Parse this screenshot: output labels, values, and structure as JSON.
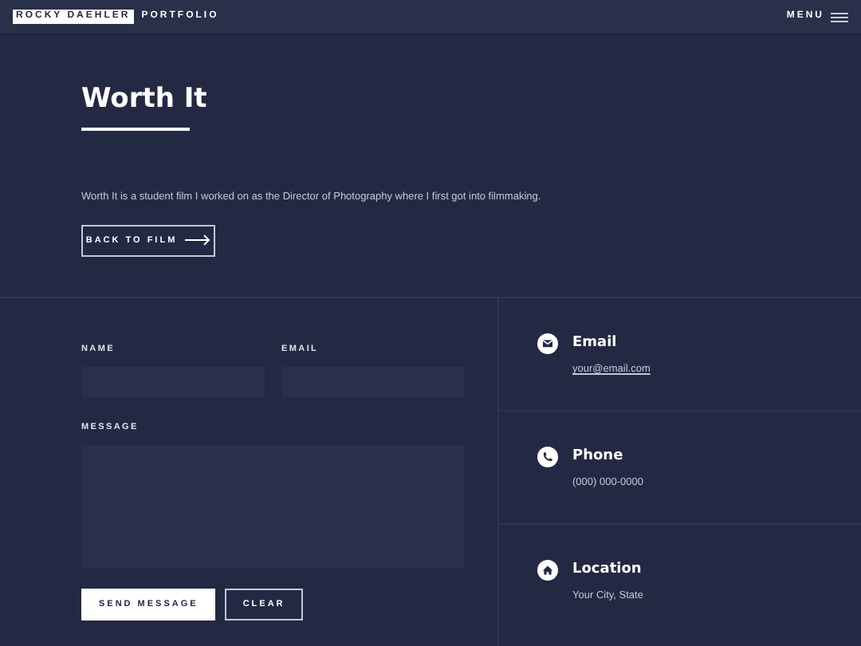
{
  "header": {
    "logo": "ROCKY DAEHLER",
    "subtitle": "PORTFOLIO",
    "menu": "MENU"
  },
  "banner": {
    "title": "Worth It",
    "description": "Worth It is a student film I worked on as the Director of Photography where I first got into filmmaking.",
    "button": "BACK TO FILM"
  },
  "form": {
    "name_label": "NAME",
    "email_label": "EMAIL",
    "message_label": "MESSAGE",
    "buttons": [
      "SEND MESSAGE",
      "CLEAR"
    ]
  },
  "contacts": [
    {
      "kind": "email",
      "title": "Email",
      "value": "your@email.com"
    },
    {
      "kind": "phone",
      "title": "Phone",
      "value": "(000) 000-0000"
    },
    {
      "kind": "location",
      "title": "Location",
      "value": "Your City, State"
    }
  ]
}
